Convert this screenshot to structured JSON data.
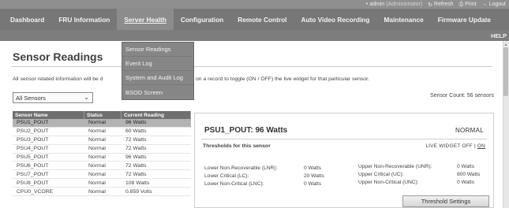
{
  "topbar": {
    "user": "admin",
    "role": "(Administrator)",
    "refresh_label": "Refresh",
    "print_label": "Print",
    "logout_label": "Logout"
  },
  "nav": {
    "items": [
      {
        "label": "Dashboard"
      },
      {
        "label": "FRU Information"
      },
      {
        "label": "Server Health"
      },
      {
        "label": "Configuration"
      },
      {
        "label": "Remote Control"
      },
      {
        "label": "Auto Video Recording"
      },
      {
        "label": "Maintenance"
      },
      {
        "label": "Firmware Update"
      }
    ],
    "active_index": 2,
    "help_label": "HELP"
  },
  "dropdown": {
    "items": [
      "Sensor Readings",
      "Event Log",
      "System and Audit Log",
      "BSOD Screen"
    ]
  },
  "page": {
    "title": "Sensor Readings",
    "info_text_start": "All sensor related information will be d",
    "info_text_end": "on a record to toggle (ON / OFF) the live widget for that particular sensor.",
    "filter_value": "All Sensors",
    "sensor_count": "Sensor Count: 56 sensors"
  },
  "table": {
    "headers": [
      "Sensor Name",
      "Status",
      "Current Reading"
    ],
    "rows": [
      {
        "name": "PSU1_POUT",
        "status": "Normal",
        "reading": "96 Watts"
      },
      {
        "name": "PSU2_POUT",
        "status": "Normal",
        "reading": "60 Watts"
      },
      {
        "name": "PSU3_POUT",
        "status": "Normal",
        "reading": "72 Watts"
      },
      {
        "name": "PSU4_POUT",
        "status": "Normal",
        "reading": "72 Watts"
      },
      {
        "name": "PSU5_POUT",
        "status": "Normal",
        "reading": "96 Watts"
      },
      {
        "name": "PSU6_POUT",
        "status": "Normal",
        "reading": "72 Watts"
      },
      {
        "name": "PSU7_POUT",
        "status": "Normal",
        "reading": "72 Watts"
      },
      {
        "name": "PSU8_POUT",
        "status": "Normal",
        "reading": "108 Watts"
      },
      {
        "name": "CPU0_VCORE",
        "status": "Normal",
        "reading": "0.859 Volts"
      }
    ]
  },
  "detail": {
    "title": "PSU1_POUT: 96 Watts",
    "status": "NORMAL",
    "thresholds_heading": "Thresholds for this sensor",
    "live_widget": "LIVE WIDGET",
    "off": "OFF",
    "on": "ON",
    "separator": "|",
    "lower_lnr_label": "Lower Non-Recoverable (LNR):",
    "lower_lnr_value": "0 Watts",
    "lower_lc_label": "Lower Critical (LC):",
    "lower_lc_value": "20 Watts",
    "lower_lnc_label": "Lower Non-Critical (LNC):",
    "lower_lnc_value": "0 Watts",
    "upper_unr_label": "Upper Non-Recoverable (UNR):",
    "upper_unr_value": "0 Watts",
    "upper_uc_label": "Upper Critical (UC):",
    "upper_uc_value": "800 Watts",
    "upper_unc_label": "Upper Non-Critical (UNC):",
    "upper_unc_value": "0 Watts",
    "threshold_button": "Threshold Settings"
  }
}
